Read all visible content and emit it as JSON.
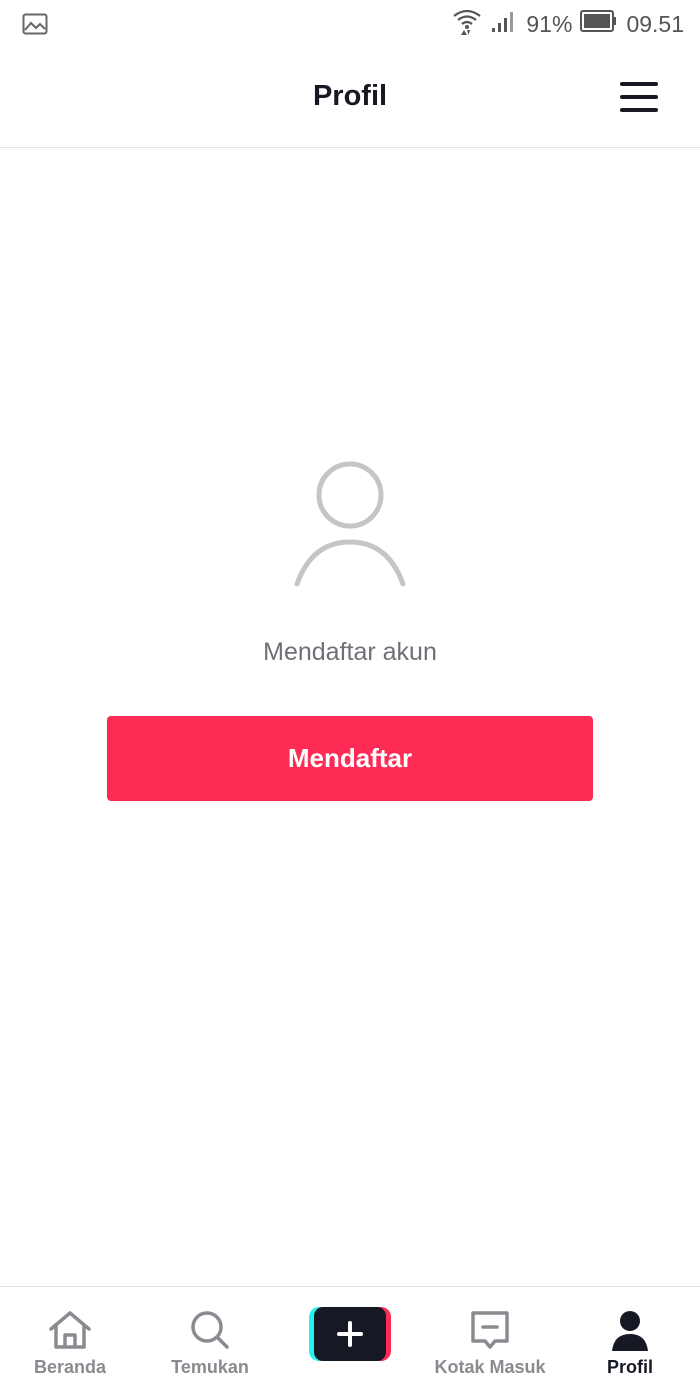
{
  "status_bar": {
    "gallery_icon": "image-icon",
    "wifi_icon": "wifi-icon",
    "signal_icon": "signal-icon",
    "battery_percent": "91%",
    "battery_icon": "battery-icon",
    "time": "09.51"
  },
  "header": {
    "title": "Profil",
    "menu_icon": "hamburger-menu-icon"
  },
  "main": {
    "avatar_icon": "user-placeholder-icon",
    "prompt": "Mendaftar akun",
    "signup_button_label": "Mendaftar"
  },
  "bottom_nav": {
    "items": [
      {
        "label": "Beranda",
        "icon": "home-icon",
        "active": false
      },
      {
        "label": "Temukan",
        "icon": "search-icon",
        "active": false
      },
      {
        "label": "",
        "icon": "plus-icon",
        "active": false
      },
      {
        "label": "Kotak Masuk",
        "icon": "inbox-icon",
        "active": false
      },
      {
        "label": "Profil",
        "icon": "profile-icon",
        "active": true
      }
    ]
  },
  "colors": {
    "accent": "#fe2c55",
    "secondary_accent": "#25f4ee",
    "text_primary": "#161823",
    "text_secondary": "#8a8b91"
  }
}
